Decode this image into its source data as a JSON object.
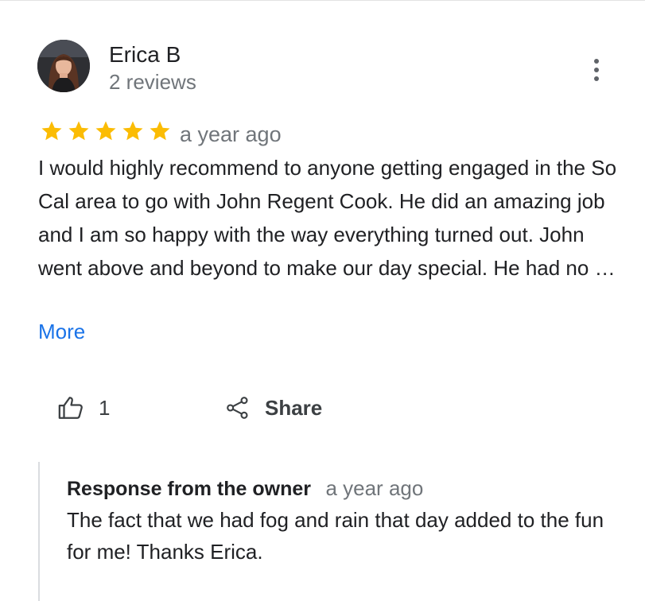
{
  "reviewer": {
    "name": "Erica B",
    "review_count": "2 reviews"
  },
  "review": {
    "rating": 5,
    "max_rating": 5,
    "star_color": "#fbbc04",
    "time": "a year ago",
    "text": "I would highly recommend to anyone getting engaged in the So Cal area to go with John Regent Cook. He did an amazing job and I am so happy with the way everything turned out. John went above and beyond to make our day special. He had no …",
    "more_label": "More"
  },
  "actions": {
    "like_icon": "thumbs-up-icon",
    "like_count": "1",
    "share_icon": "share-icon",
    "share_label": "Share",
    "more_options_icon": "more-vert-icon"
  },
  "owner_response": {
    "title": "Response from the owner",
    "time": "a year ago",
    "text": "The fact that we had fog and rain that day added to the fun for me! Thanks Erica."
  },
  "colors": {
    "link": "#1a73e8",
    "secondary_text": "#70757a",
    "primary_text": "#202124"
  }
}
